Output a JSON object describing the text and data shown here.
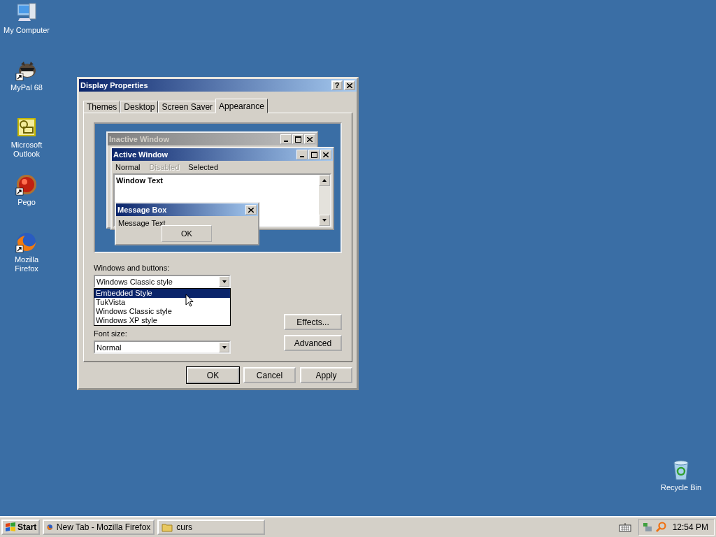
{
  "desktop_icons": [
    {
      "label": "My Computer",
      "kind": "computer",
      "shortcut": false
    },
    {
      "label": "MyPal 68",
      "kind": "raccoon",
      "shortcut": true
    },
    {
      "label": "Microsoft Outlook",
      "kind": "outlook",
      "shortcut": false
    },
    {
      "label": "Pego",
      "kind": "orb",
      "shortcut": true
    },
    {
      "label": "Mozilla Firefox",
      "kind": "firefox",
      "shortcut": true
    }
  ],
  "recycle_bin": {
    "label": "Recycle Bin"
  },
  "dialog": {
    "title": "Display Properties",
    "help": "?",
    "tabs": [
      {
        "label": "Themes",
        "selected": false
      },
      {
        "label": "Desktop",
        "selected": false
      },
      {
        "label": "Screen Saver",
        "selected": false
      },
      {
        "label": "Appearance",
        "selected": true
      }
    ],
    "preview": {
      "inactive_title": "Inactive Window",
      "active_title": "Active Window",
      "menu": [
        {
          "label": "Normal",
          "disabled": false
        },
        {
          "label": "Disabled",
          "disabled": true
        },
        {
          "label": "Selected",
          "disabled": false
        }
      ],
      "window_text": "Window Text",
      "message_title": "Message Box",
      "message_text": "Message Text",
      "message_button": "OK"
    },
    "windows_buttons_label": "Windows and buttons:",
    "windows_buttons_value": "Windows Classic style",
    "style_options": [
      {
        "label": "Embedded Style",
        "selected": true
      },
      {
        "label": "TukVista",
        "selected": false
      },
      {
        "label": "Windows Classic style",
        "selected": false
      },
      {
        "label": "Windows XP style",
        "selected": false
      }
    ],
    "font_size_label": "Font size:",
    "font_size_value": "Normal",
    "side_buttons": [
      "Effects...",
      "Advanced"
    ],
    "buttons": [
      "OK",
      "Cancel",
      "Apply"
    ]
  },
  "taskbar": {
    "start": "Start",
    "tasks": [
      {
        "label": "New Tab - Mozilla Firefox",
        "kind": "firefox"
      },
      {
        "label": "curs",
        "kind": "folder"
      }
    ],
    "clock": "12:54 PM"
  }
}
